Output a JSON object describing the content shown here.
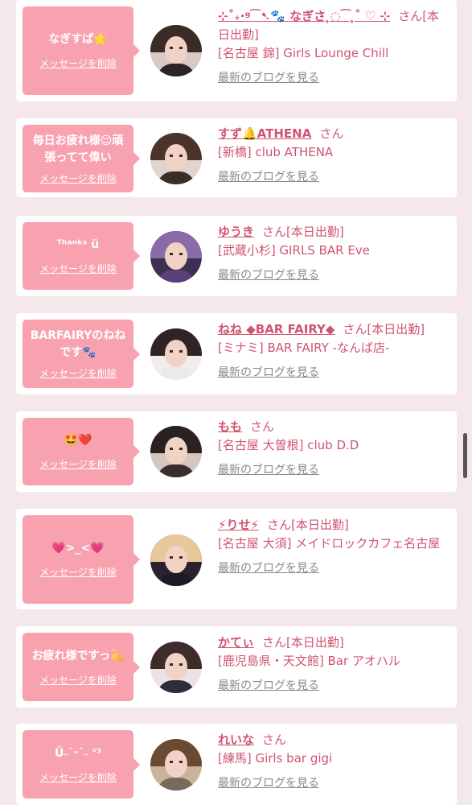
{
  "delete_label": "メッセージを削除",
  "blog_label": "最新のブログを見る",
  "entries": [
    {
      "message": "なぎすぱ🌟",
      "name": "⊹˚₊‧ᵍ⁀➷🐾 なぎさ ̥◌⁀ ̥˚ ♡ ⊹",
      "suffix": "さん[本日出勤]",
      "shop": "[名古屋 錦] Girls Lounge Chill"
    },
    {
      "message": "毎日お疲れ様😌頑張ってて偉い",
      "name": "すず🔔ATHENA",
      "suffix": "さん",
      "shop": "[新橋] club ATHENA"
    },
    {
      "message": "ᵀʰᵃⁿᵏˢ ü",
      "name": "ゆうき",
      "suffix": "さん[本日出勤]",
      "shop": "[武蔵小杉] GIRLS BAR Eve"
    },
    {
      "message": "BARFAIRYのねねです🐾",
      "name": "ねね ◆BAR FAIRY◆",
      "suffix": "さん[本日出勤]",
      "shop": "[ミナミ] BAR FAIRY -なんば店-"
    },
    {
      "message": "🤩❤️",
      "name": "もも",
      "suffix": "さん",
      "shop": "[名古屋 大曽根] club D.D"
    },
    {
      "message": "💗>_<💗",
      "name": "⚡りせ⚡",
      "suffix": "さん[本日出勤]",
      "shop": "[名古屋 大須] メイドロックカフェ名古屋"
    },
    {
      "message": "お疲れ様ですっ💫",
      "name": "かてぃ",
      "suffix": "さん[本日出勤]",
      "shop": "[鹿児島県・天文館] Bar アオハル"
    },
    {
      "message": "Ű˶˙ᵕ˙˶ ᐡ³",
      "name": "れいな",
      "suffix": "さん",
      "shop": "[練馬] Girls bar gigi"
    }
  ]
}
